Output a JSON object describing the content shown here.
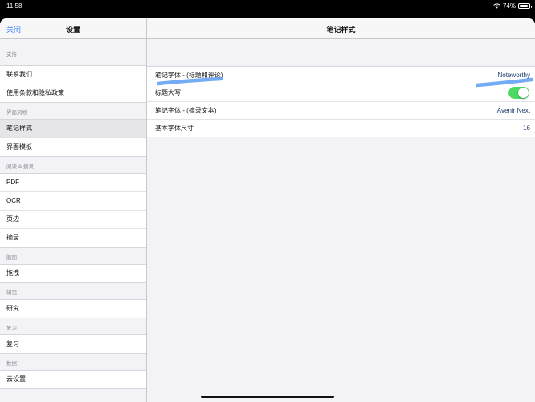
{
  "status_bar": {
    "time": "11:58",
    "battery_percent": "74%"
  },
  "sidebar": {
    "close_label": "关闭",
    "title": "设置",
    "sections": [
      {
        "title": "支持",
        "items": [
          {
            "label": "联系我们"
          },
          {
            "label": "使用条款和隐私政策"
          }
        ]
      },
      {
        "title": "界面风格",
        "items": [
          {
            "label": "笔记样式",
            "selected": true
          },
          {
            "label": "界面模板"
          }
        ]
      },
      {
        "title": "阅读 & 摘录",
        "items": [
          {
            "label": "PDF"
          },
          {
            "label": "OCR"
          },
          {
            "label": "页边"
          },
          {
            "label": "摘录"
          }
        ]
      },
      {
        "title": "脑图",
        "items": [
          {
            "label": "拖拽"
          }
        ]
      },
      {
        "title": "研究",
        "items": [
          {
            "label": "研究"
          }
        ]
      },
      {
        "title": "复习",
        "items": [
          {
            "label": "复习"
          }
        ]
      },
      {
        "title": "数据",
        "items": [
          {
            "label": "云设置"
          }
        ]
      }
    ]
  },
  "main": {
    "title": "笔记样式",
    "rows": [
      {
        "label": "笔记字体 - (标题和评论)",
        "value": "Noteworthy"
      },
      {
        "label": "标题大写",
        "toggle_on": true
      },
      {
        "label": "笔记字体 - (摘录文本)",
        "value": "Avenir Next"
      },
      {
        "label": "基本字体尺寸",
        "value": "16"
      }
    ]
  },
  "colors": {
    "accent": "#2f7cf6",
    "toggle_on": "#4cd964",
    "annotation": "#5a9cf2"
  }
}
